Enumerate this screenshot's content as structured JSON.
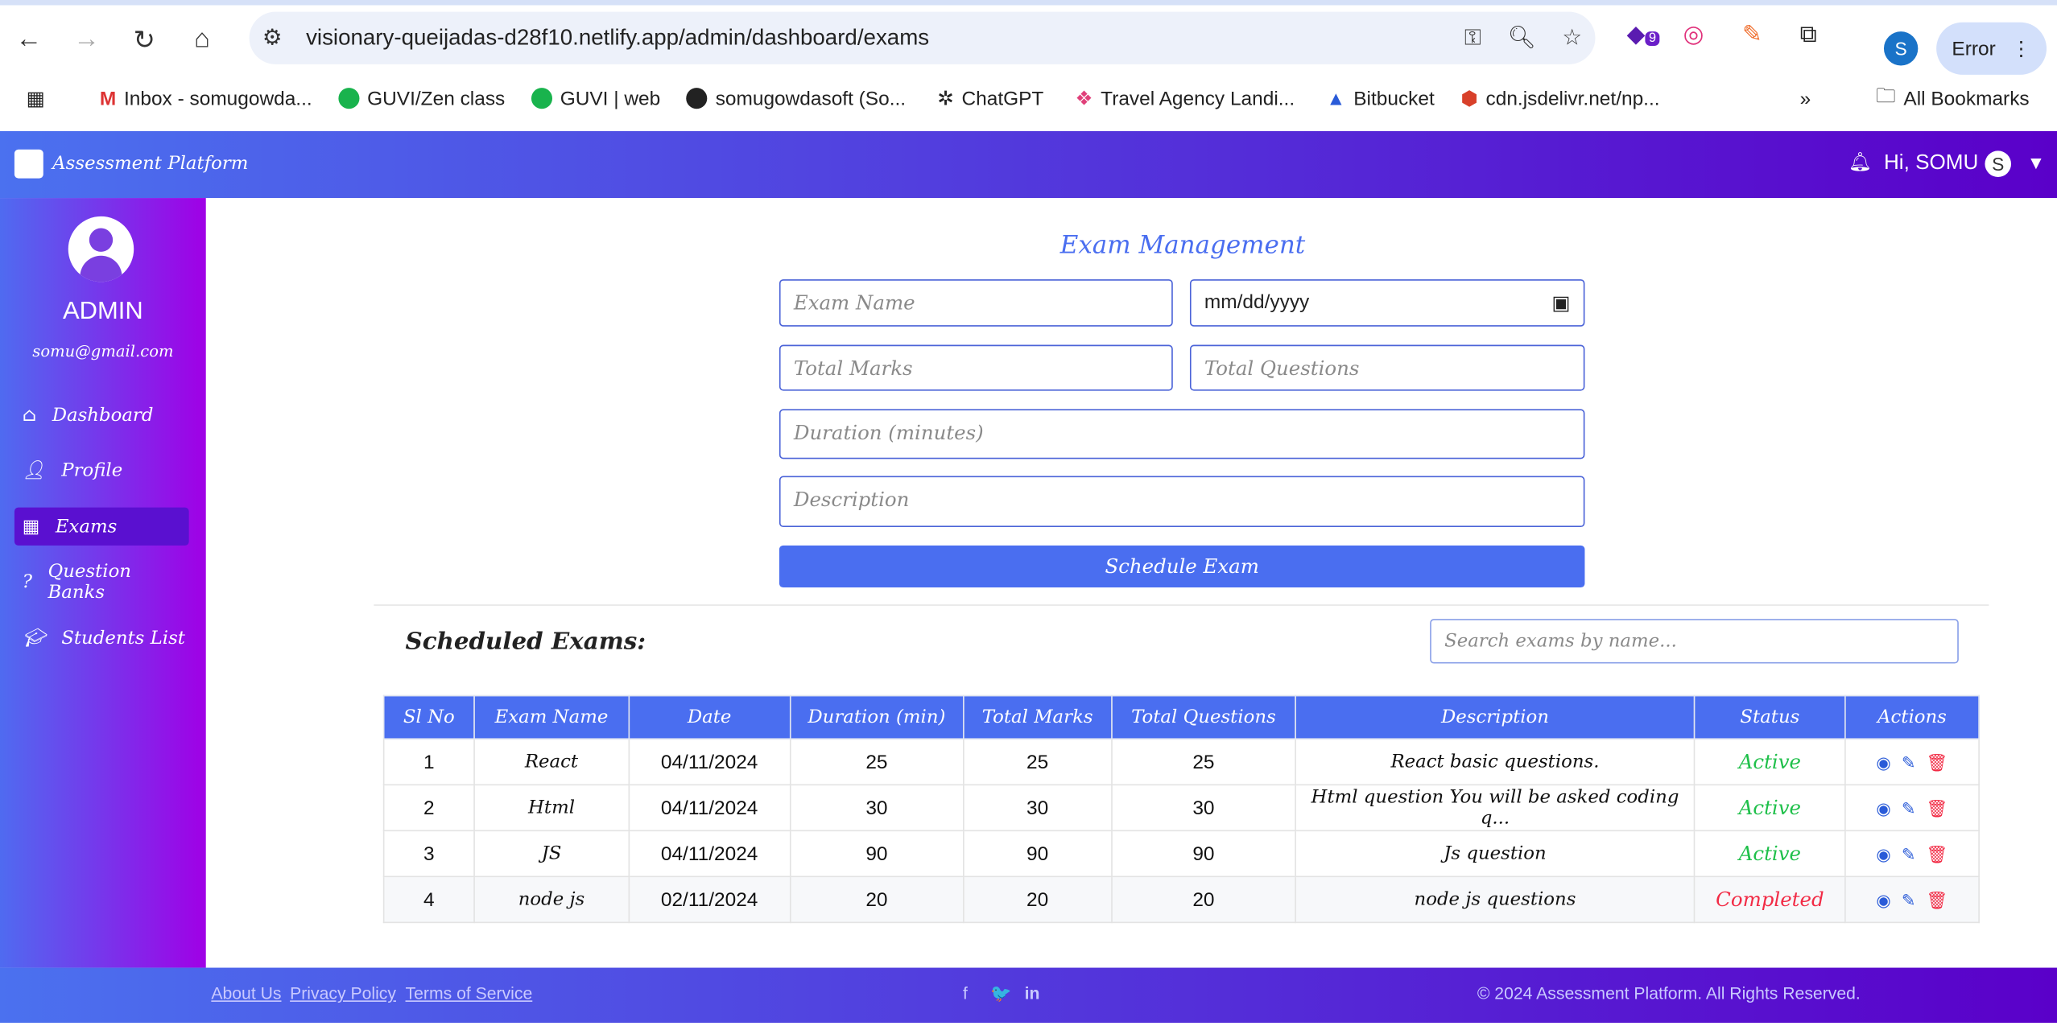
{
  "browser": {
    "url": "visionary-queijadas-d28f10.netlify.app/admin/dashboard/exams",
    "profile_initial": "S",
    "error_label": "Error",
    "extension_badge": "9",
    "bookmarks": [
      "Inbox - somugowda...",
      "GUVI/Zen class",
      "GUVI | web",
      "somugowdasoft (So...",
      "ChatGPT",
      "Travel Agency Landi...",
      "Bitbucket",
      "cdn.jsdelivr.net/np..."
    ],
    "all_bookmarks": "All Bookmarks",
    "more": "»"
  },
  "header": {
    "brand": "Assessment Platform",
    "greeting": "Hi, SOMU",
    "avatar_initial": "S"
  },
  "sidebar": {
    "role": "ADMIN",
    "email": "somu@gmail.com",
    "items": [
      {
        "label": "Dashboard"
      },
      {
        "label": "Profile"
      },
      {
        "label": "Exams"
      },
      {
        "label": "Question Banks"
      },
      {
        "label": "Students List"
      }
    ]
  },
  "form": {
    "title": "Exam Management",
    "exam_name_placeholder": "Exam Name",
    "date_value": "mm/dd/yyyy",
    "total_marks_placeholder": "Total Marks",
    "total_questions_placeholder": "Total Questions",
    "duration_placeholder": "Duration (minutes)",
    "description_placeholder": "Description",
    "submit": "Schedule Exam"
  },
  "scheduled": {
    "title": "Scheduled Exams:",
    "search_placeholder": "Search exams by name...",
    "columns": [
      "Sl No",
      "Exam Name",
      "Date",
      "Duration (min)",
      "Total Marks",
      "Total Questions",
      "Description",
      "Status",
      "Actions"
    ],
    "rows": [
      {
        "sl": "1",
        "name": "React",
        "date": "04/11/2024",
        "duration": "25",
        "marks": "25",
        "questions": "25",
        "description": "React basic questions.",
        "status": "Active"
      },
      {
        "sl": "2",
        "name": "Html",
        "date": "04/11/2024",
        "duration": "30",
        "marks": "30",
        "questions": "30",
        "description": "Html question You will be asked coding q...",
        "status": "Active"
      },
      {
        "sl": "3",
        "name": "JS",
        "date": "04/11/2024",
        "duration": "90",
        "marks": "90",
        "questions": "90",
        "description": "Js question",
        "status": "Active"
      },
      {
        "sl": "4",
        "name": "node js",
        "date": "02/11/2024",
        "duration": "20",
        "marks": "20",
        "questions": "20",
        "description": "node js questions",
        "status": "Completed"
      }
    ]
  },
  "footer": {
    "links": [
      "About Us",
      "Privacy Policy",
      "Terms of Service"
    ],
    "copyright": "© 2024 Assessment Platform. All Rights Reserved.",
    "social": [
      "f",
      "🐦",
      "in"
    ]
  }
}
